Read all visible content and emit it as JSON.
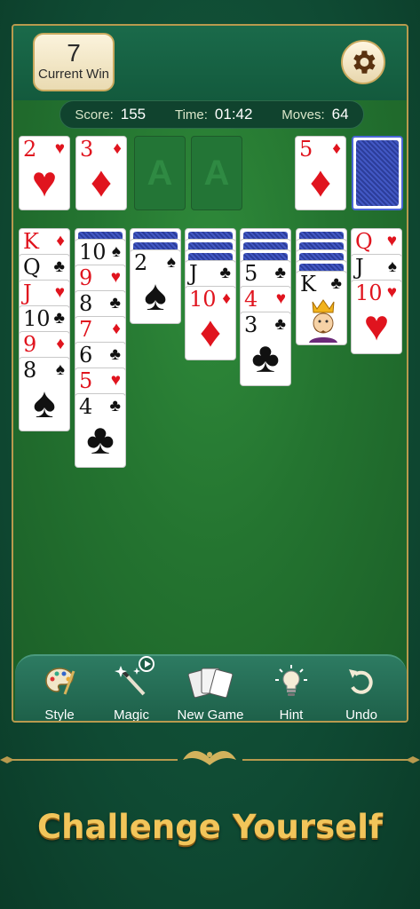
{
  "header": {
    "current_win_value": "7",
    "current_win_label": "Current Win"
  },
  "stats": {
    "score_label": "Score:",
    "score_value": "155",
    "time_label": "Time:",
    "time_value": "01:42",
    "moves_label": "Moves:",
    "moves_value": "64"
  },
  "foundations": [
    {
      "rank": "2",
      "suit": "♥",
      "color": "red"
    },
    {
      "rank": "3",
      "suit": "♦",
      "color": "red"
    },
    {
      "placeholder": "A"
    },
    {
      "placeholder": "A"
    }
  ],
  "waste": {
    "rank": "5",
    "suit": "♦",
    "color": "red"
  },
  "tableau": [
    {
      "hidden": 0,
      "cards": [
        {
          "rank": "K",
          "suit": "♦"
        },
        {
          "rank": "Q",
          "suit": "♣"
        },
        {
          "rank": "J",
          "suit": "♥"
        },
        {
          "rank": "10",
          "suit": "♣"
        },
        {
          "rank": "9",
          "suit": "♦"
        },
        {
          "rank": "8",
          "suit": "♠"
        }
      ]
    },
    {
      "hidden": 1,
      "cards": [
        {
          "rank": "10",
          "suit": "♠"
        },
        {
          "rank": "9",
          "suit": "♥"
        },
        {
          "rank": "8",
          "suit": "♣"
        },
        {
          "rank": "7",
          "suit": "♦"
        },
        {
          "rank": "6",
          "suit": "♣"
        },
        {
          "rank": "5",
          "suit": "♥"
        },
        {
          "rank": "4",
          "suit": "♣"
        }
      ]
    },
    {
      "hidden": 2,
      "cards": [
        {
          "rank": "2",
          "suit": "♠"
        }
      ]
    },
    {
      "hidden": 3,
      "cards": [
        {
          "rank": "J",
          "suit": "♣"
        },
        {
          "rank": "10",
          "suit": "♦"
        }
      ]
    },
    {
      "hidden": 3,
      "cards": [
        {
          "rank": "5",
          "suit": "♣"
        },
        {
          "rank": "4",
          "suit": "♥"
        },
        {
          "rank": "3",
          "suit": "♣"
        }
      ]
    },
    {
      "hidden": 4,
      "cards": [
        {
          "rank": "K",
          "suit": "♣"
        }
      ]
    },
    {
      "hidden": 0,
      "cards": [
        {
          "rank": "Q",
          "suit": "♥"
        },
        {
          "rank": "J",
          "suit": "♠"
        },
        {
          "rank": "10",
          "suit": "♥"
        }
      ]
    }
  ],
  "toolbar": {
    "style_label": "Style",
    "magic_label": "Magic",
    "new_game_label": "New Game",
    "hint_label": "Hint",
    "undo_label": "Undo"
  },
  "tagline": "Challenge Yourself",
  "colors": {
    "felt": "#247430",
    "frame_border": "#b89a4e",
    "card_red": "#e0141e",
    "tagline": "#f2c55a"
  }
}
